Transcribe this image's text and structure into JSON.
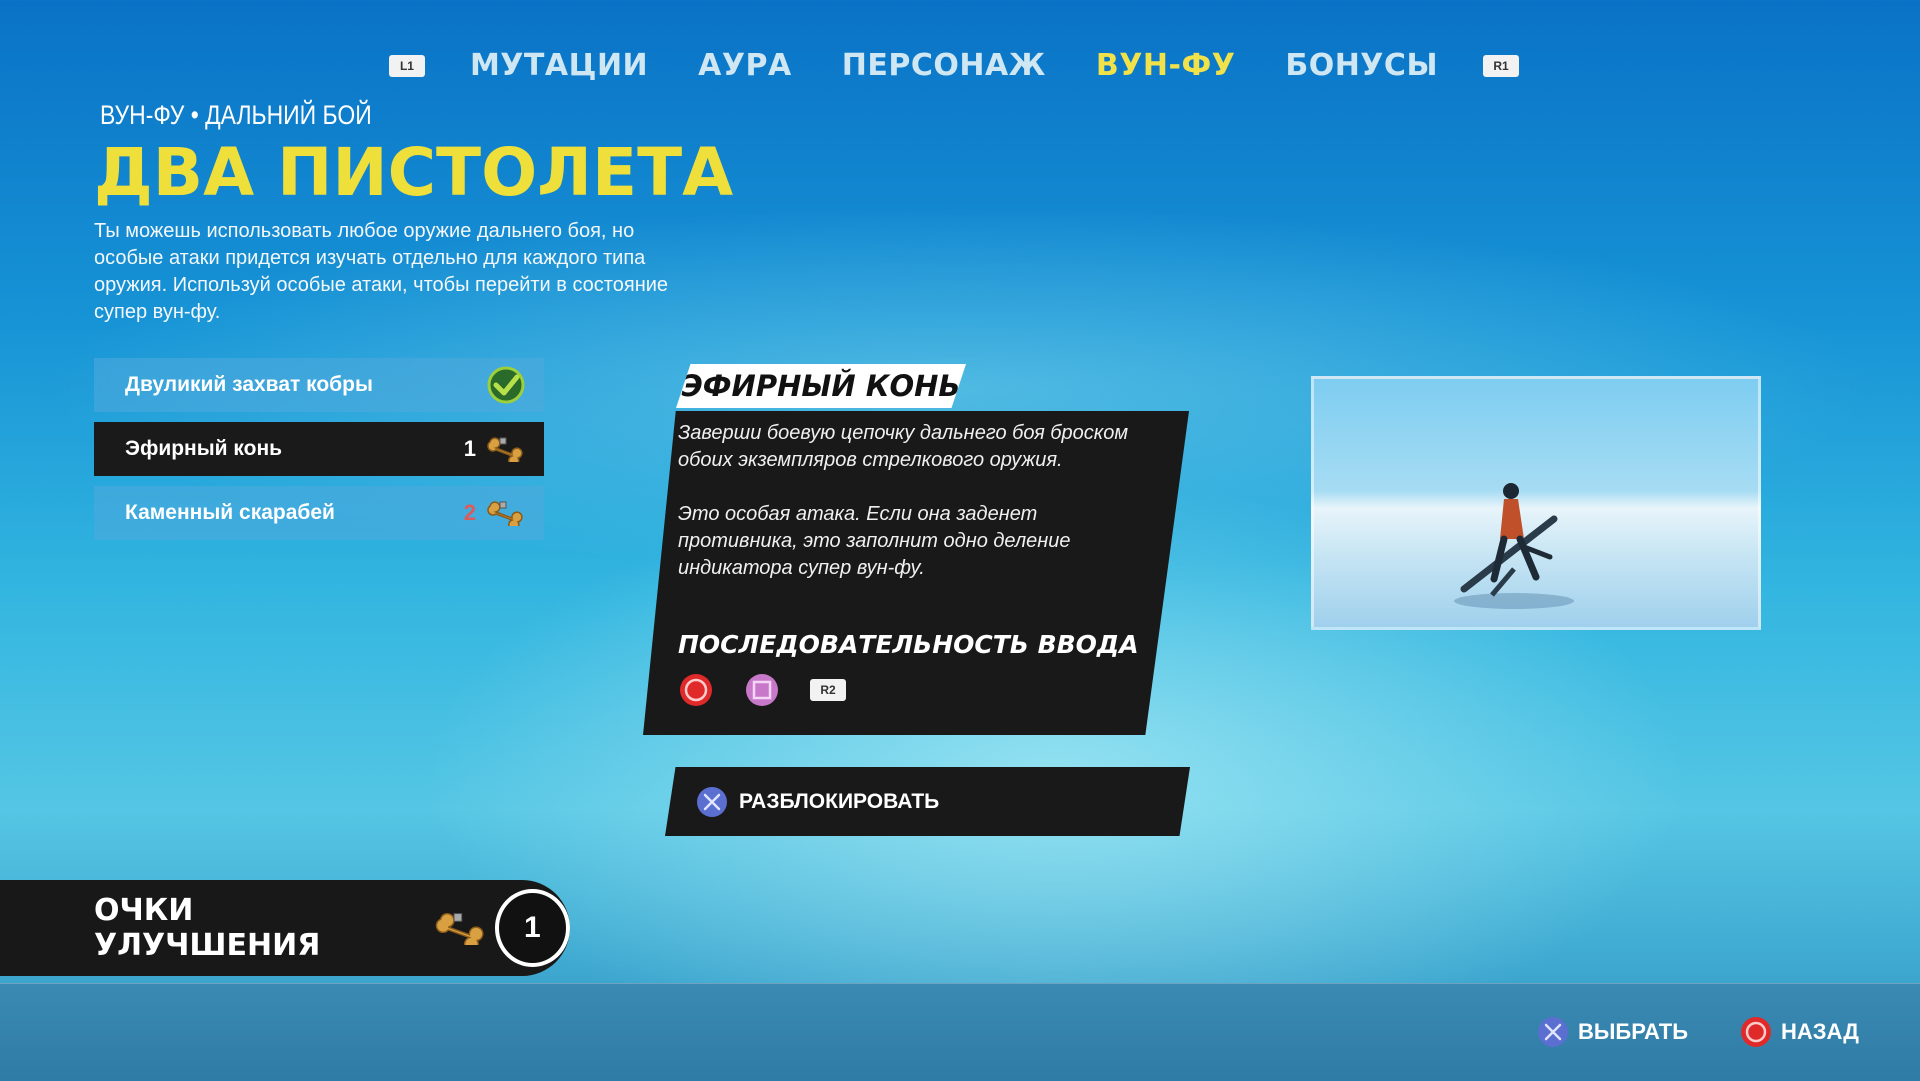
{
  "tabs": {
    "left_button": "L1",
    "right_button": "R1",
    "items": [
      "МУТАЦИИ",
      "АУРА",
      "ПЕРСОНАЖ",
      "ВУН-ФУ",
      "БОНУСЫ"
    ],
    "active": "ВУН-ФУ"
  },
  "header": {
    "subtitle": "ВУН-ФУ • ДАЛЬНИЙ БОЙ",
    "title": "ДВА ПИСТОЛЕТА",
    "description": "Ты можешь использовать любое оружие дальнего боя, но особые атаки придется изучать отдельно для каждого типа оружия. Используй особые атаки, чтобы перейти в состояние супер вун-фу."
  },
  "attacks": [
    {
      "label": "Двуликий захват кобры",
      "status": "unlocked"
    },
    {
      "label": "Эфирный конь",
      "cost": "1",
      "status": "selected"
    },
    {
      "label": "Каменный скарабей",
      "cost": "2",
      "status": "locked"
    }
  ],
  "detail": {
    "title": "ЭФИРНЫЙ КОНЬ",
    "text1": "Заверши боевую цепочку дальнего боя броском обоих экземпляров стрелкового оружия.",
    "text2": "Это особая атака. Если она заденет противника, это заполнит одно деление индикатора супер вун-фу.",
    "sequence_title": "ПОСЛЕДОВАТЕЛЬНОСТЬ ВВОДА",
    "sequence": [
      "circle-button",
      "square-button",
      "R2"
    ],
    "unlock_label": "РАЗБЛОКИРОВАТЬ"
  },
  "upgrade_points": {
    "label": "ОЧКИ УЛУЧШЕНИЯ",
    "value": "1"
  },
  "footer": {
    "select_label": "ВЫБРАТЬ",
    "back_label": "НАЗАД"
  },
  "colors": {
    "accent": "#eedf3a",
    "circle": "#e02a2a",
    "square": "#c878c8",
    "cross": "#5a6fd0"
  }
}
